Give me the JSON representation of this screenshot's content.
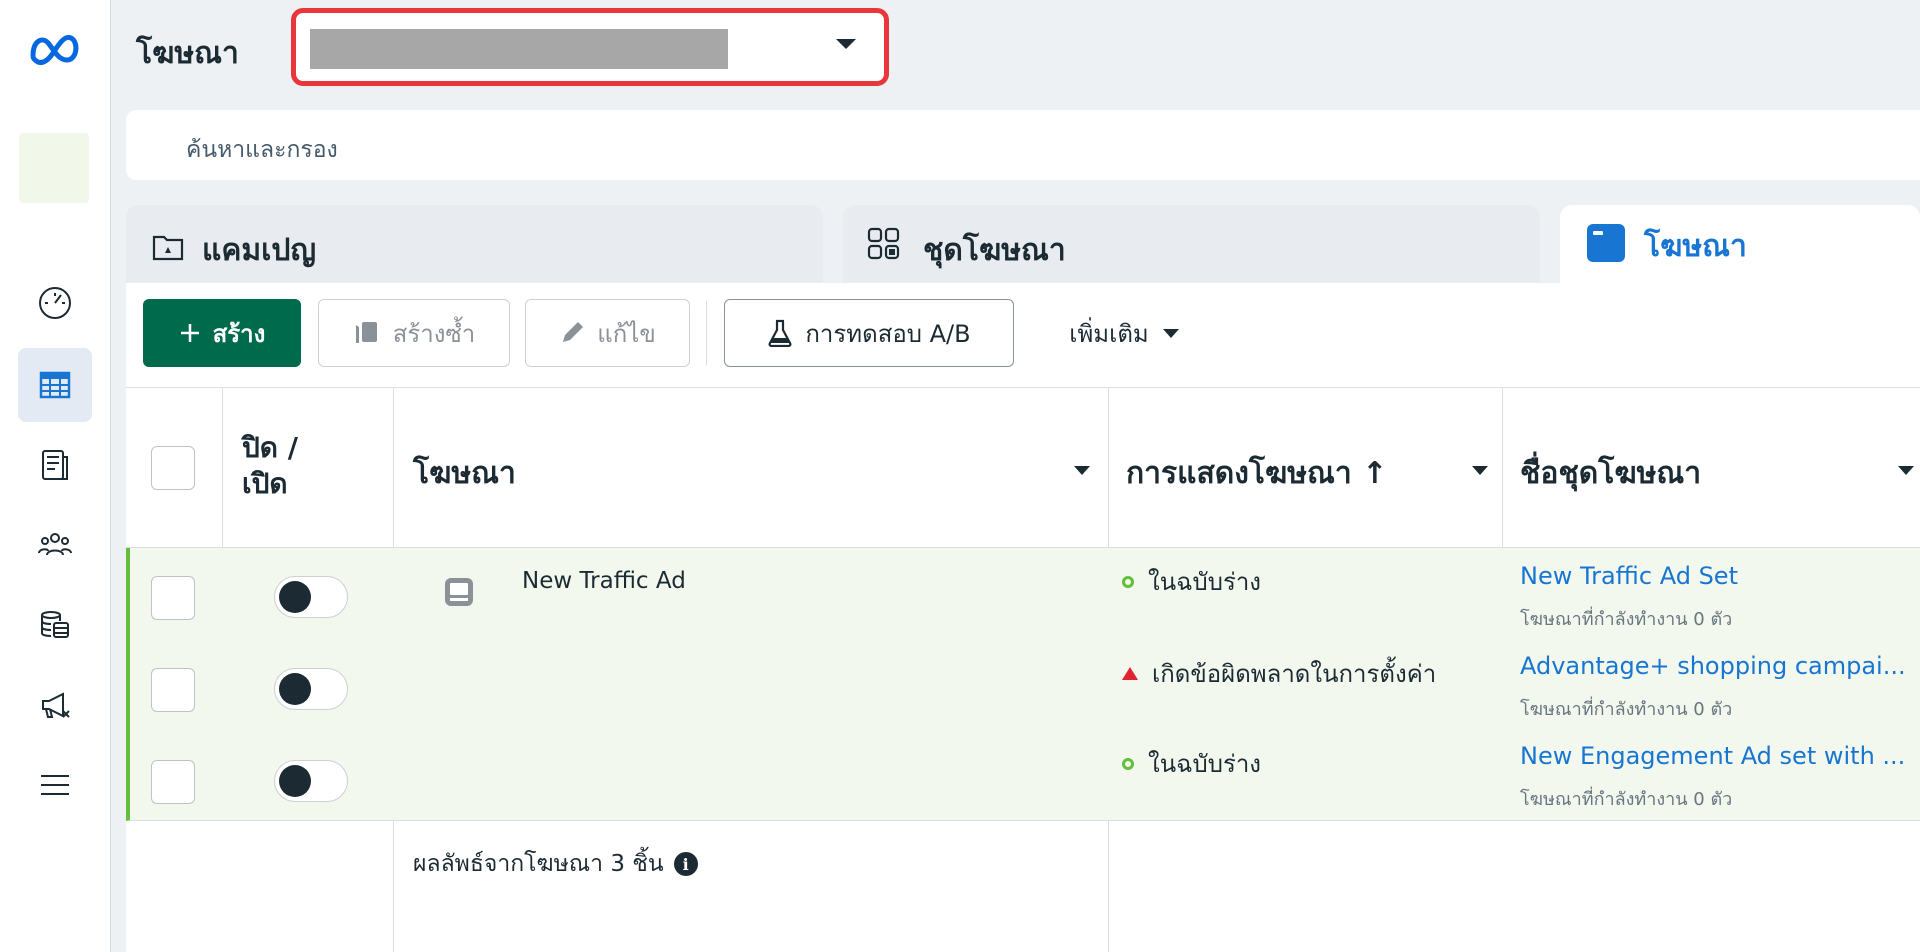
{
  "header": {
    "title": "โฆษณา",
    "account_selector_value": ""
  },
  "search": {
    "placeholder": "ค้นหาและกรอง"
  },
  "tabs": [
    {
      "label": "แคมเปญ",
      "icon": "campaign-folder-icon"
    },
    {
      "label": "ชุดโฆษณา",
      "icon": "ad-set-grid-icon"
    },
    {
      "label": "โฆษณา",
      "icon": "ad-icon",
      "active": true
    }
  ],
  "toolbar": {
    "create_label": "สร้าง",
    "duplicate_label": "สร้างซ้ำ",
    "edit_label": "แก้ไข",
    "ab_test_label": "การทดสอบ A/B",
    "more_label": "เพิ่มเติม"
  },
  "table": {
    "columns": {
      "toggle": "ปิด /\nเปิด",
      "ad": "โฆษณา",
      "delivery": "การแสดงโฆษณา ↑",
      "ad_set_name": "ชื่อชุดโฆษณา"
    },
    "ad_name": "New Traffic Ad",
    "rows": [
      {
        "delivery": "ในฉบับร่าง",
        "delivery_status": "draft",
        "ad_set": "New Traffic Ad Set",
        "ad_set_sub": "โฆษณาที่กำลังทำงาน 0 ตัว",
        "on": false
      },
      {
        "delivery": "เกิดข้อผิดพลาดในการตั้งค่า",
        "delivery_status": "error",
        "ad_set": "Advantage+ shopping campai...",
        "ad_set_sub": "โฆษณาที่กำลังทำงาน 0 ตัว",
        "on": false
      },
      {
        "delivery": "ในฉบับร่าง",
        "delivery_status": "draft",
        "ad_set": "New Engagement Ad set with ...",
        "ad_set_sub": "โฆษณาที่กำลังทำงาน 0 ตัว",
        "on": false
      }
    ],
    "footer": "ผลลัพธ์จากโฆษณา 3 ชิ้น"
  },
  "colors": {
    "brand_green": "#006b4c",
    "link_blue": "#1876d2",
    "highlight_red": "#e8363a",
    "draft_green": "#63be3b",
    "error_red": "#e0232e"
  }
}
